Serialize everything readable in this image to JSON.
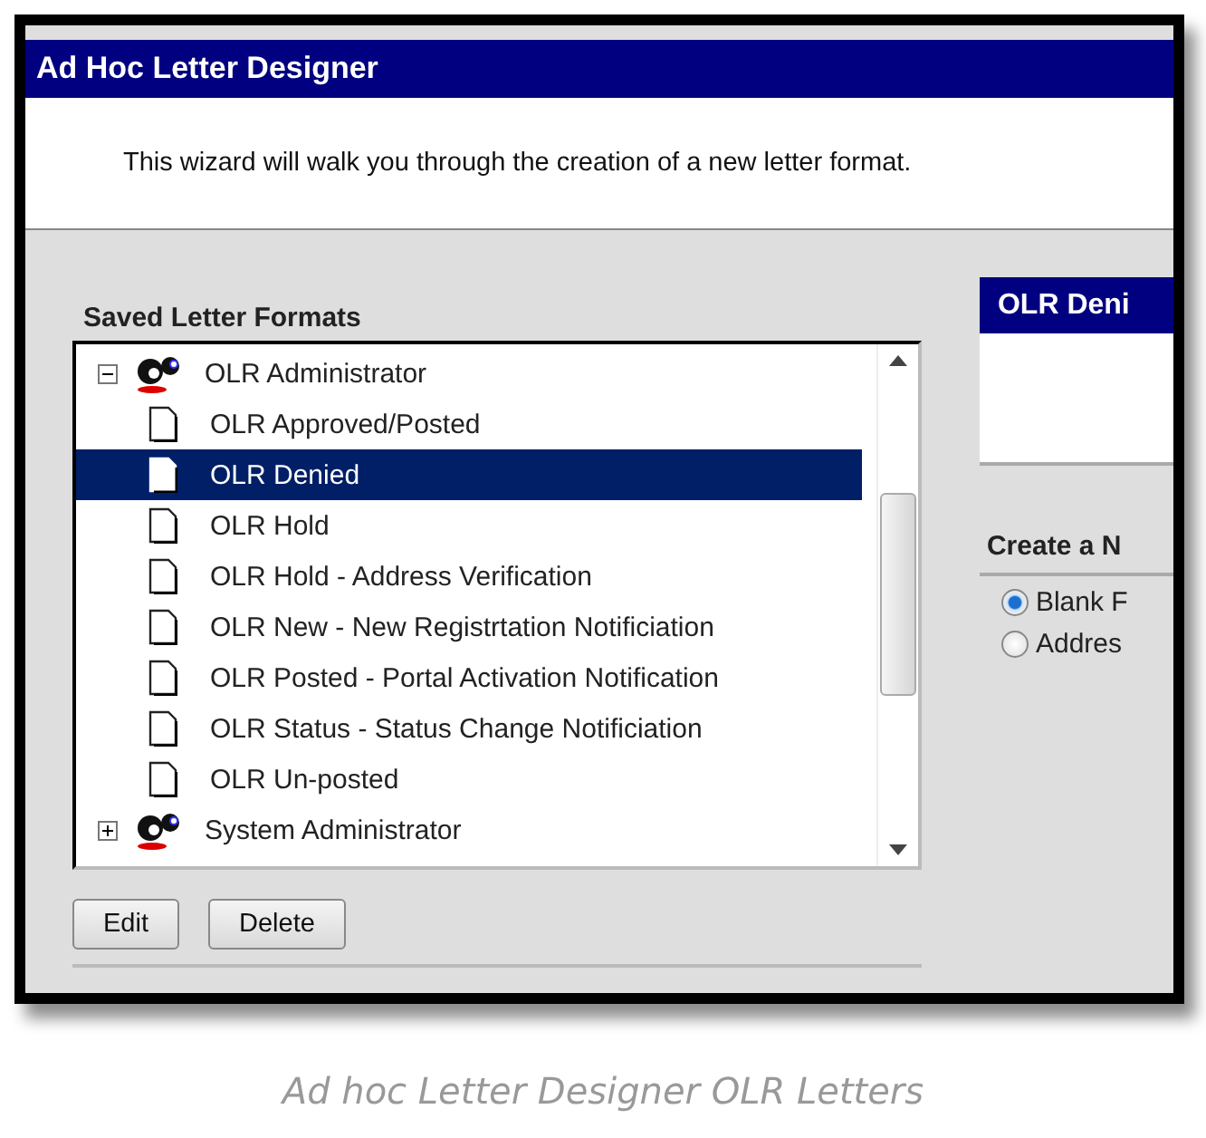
{
  "window": {
    "title": "Ad Hoc Letter Designer"
  },
  "intro": "This wizard will walk you through the creation of a new letter format.",
  "saved_formats": {
    "label": "Saved Letter Formats",
    "tree": [
      {
        "label": "OLR Administrator",
        "expanded": true,
        "children": [
          {
            "label": "OLR Approved/Posted",
            "selected": false
          },
          {
            "label": "OLR Denied",
            "selected": true
          },
          {
            "label": "OLR Hold",
            "selected": false
          },
          {
            "label": "OLR Hold - Address Verification",
            "selected": false
          },
          {
            "label": "OLR New - New Registrtation Notificiation",
            "selected": false
          },
          {
            "label": "OLR Posted - Portal Activation Notification",
            "selected": false
          },
          {
            "label": "OLR Status - Status Change Notificiation",
            "selected": false
          },
          {
            "label": "OLR Un-posted",
            "selected": false
          }
        ]
      },
      {
        "label": "System Administrator",
        "expanded": false
      }
    ],
    "buttons": [
      "Edit",
      "Delete"
    ]
  },
  "detail": {
    "title": "OLR Deni"
  },
  "create": {
    "label": "Create a N",
    "options": [
      {
        "label": "Blank F",
        "selected": true
      },
      {
        "label": "Addres",
        "selected": false
      }
    ]
  },
  "caption": "Ad hoc Letter Designer OLR Letters"
}
